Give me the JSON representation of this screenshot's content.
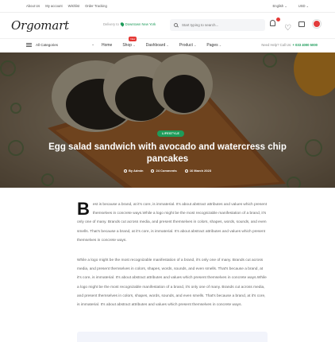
{
  "topbar": {
    "links": [
      "About Us",
      "My account",
      "Wishlist",
      "Order Tracking"
    ],
    "language": "English",
    "currency": "USD"
  },
  "header": {
    "logo": "Orgomart",
    "delivery_label": "Delivery to",
    "delivery_city": "Downtown New York",
    "search_placeholder": "Start typing to search..."
  },
  "nav": {
    "categories_label": "All Categories",
    "menu": [
      {
        "label": "Home",
        "badge": ""
      },
      {
        "label": "Shop",
        "badge": "New"
      },
      {
        "label": "Dashboard",
        "badge": ""
      },
      {
        "label": "Product",
        "badge": ""
      },
      {
        "label": "Pages",
        "badge": ""
      }
    ],
    "help_label": "Need Help? Call Us:",
    "help_phone": "+ 033 4000 5000"
  },
  "hero": {
    "category_pill": "LIFESTYLE",
    "title": "Egg salad sandwich with avocado and watercress chip pancakes",
    "author": "By Admin",
    "comments": "24 Comments",
    "date": "16 March 2023"
  },
  "article": {
    "dropcap": "B",
    "paragraph1": "est is because a brand, at it's core, is immaterial. It's about abstract attributes and values which present themselves in concrete ways.While a logo might be the most recognizable manifestation of a brand, it's only one of many. Brands cut across media, and present themselves in colors, shapes, words, sounds, and even smells. That's because a brand, at it's core, is immaterial. It's about abstract attributes and values which present themselves in concrete ways.",
    "paragraph2": "While a logo might be the most recognizable manifestation of a brand, it's only one of many. Brands cut across media, and present themselves in colors, shapes, words, sounds, and even smells. That's because a brand, at it's core, is immaterial. It's about abstract attributes and values which present themselves in concrete ways.While a logo might be the most recognizable manifestation of a brand, it's only one of many. Brands cut across media, and present themselves in colors, shapes, words, sounds, and even smells. That's because a brand, at it's core, is immaterial. It's about abstract attributes and values which present themselves in concrete ways."
  },
  "colors": {
    "brand_green": "#1e9c5a",
    "badge_red": "#e53935"
  }
}
